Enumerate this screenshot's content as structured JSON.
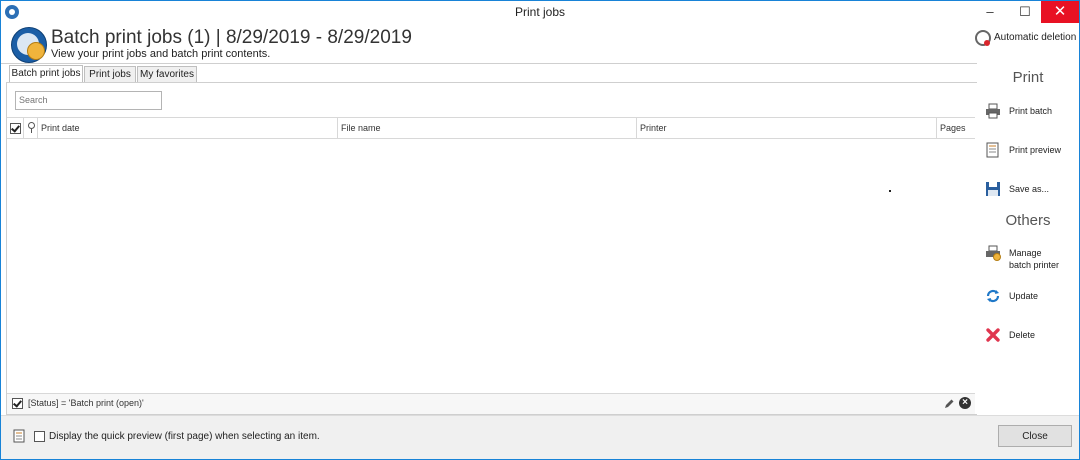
{
  "window": {
    "title": "Print jobs"
  },
  "titlebar": {
    "minimize": "–",
    "maximize": "☐",
    "close": "✕"
  },
  "header": {
    "title": "Batch print jobs (1) | 8/29/2019 - 8/29/2019",
    "subtitle": "View your print jobs and batch print contents.",
    "auto_delete_label": "Automatic deletion"
  },
  "tabs": [
    {
      "label": "Batch print jobs",
      "active": true
    },
    {
      "label": "Print jobs",
      "active": false
    },
    {
      "label": "My favorites",
      "active": false
    }
  ],
  "search": {
    "placeholder": "Search"
  },
  "grid": {
    "columns": [
      "Print date",
      "File name",
      "Printer",
      "Pages"
    ]
  },
  "filter": {
    "text": "[Status] = 'Batch print (open)'"
  },
  "sidebar": {
    "print_title": "Print",
    "print_items": [
      {
        "label": "Print batch",
        "icon": "printer-icon"
      },
      {
        "label": "Print preview",
        "icon": "preview-icon"
      },
      {
        "label": "Save as...",
        "icon": "floppy-icon"
      }
    ],
    "others_title": "Others",
    "others_items": [
      {
        "label_line1": "Manage",
        "label_line2": "batch printer",
        "icon": "manage-printer-icon"
      },
      {
        "label": "Update",
        "icon": "refresh-icon"
      },
      {
        "label": "Delete",
        "icon": "delete-icon"
      }
    ]
  },
  "footer": {
    "quick_preview_label": "Display the quick preview (first page) when selecting an item.",
    "close_label": "Close"
  },
  "colors": {
    "accent": "#1883d7",
    "close_red": "#e81123",
    "delete_red": "#e0364f",
    "refresh_blue": "#1f78c8"
  }
}
